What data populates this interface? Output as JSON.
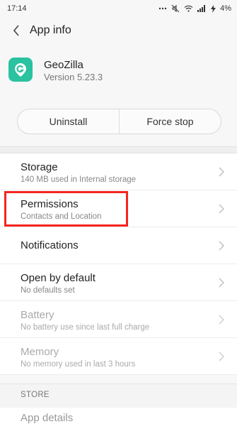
{
  "status_bar": {
    "time": "17:14",
    "battery": "4%"
  },
  "app_bar": {
    "title": "App info"
  },
  "app": {
    "name": "GeoZilla",
    "version": "Version 5.23.3",
    "icon": "geozilla-g-logo",
    "icon_color": "#2ac2a0"
  },
  "actions": {
    "uninstall": "Uninstall",
    "force_stop": "Force stop"
  },
  "settings": [
    {
      "title": "Storage",
      "subtitle": "140 MB used in Internal storage",
      "enabled": true
    },
    {
      "title": "Permissions",
      "subtitle": "Contacts and Location",
      "enabled": true,
      "highlighted": true
    },
    {
      "title": "Notifications",
      "subtitle": "",
      "enabled": true
    },
    {
      "title": "Open by default",
      "subtitle": "No defaults set",
      "enabled": true
    },
    {
      "title": "Battery",
      "subtitle": "No battery use since last full charge",
      "enabled": false
    },
    {
      "title": "Memory",
      "subtitle": "No memory used in last 3 hours",
      "enabled": false
    }
  ],
  "store": {
    "section_label": "STORE",
    "app_details": "App details"
  },
  "colors": {
    "highlight": "#f5251f",
    "background": "#f7f7f7"
  }
}
